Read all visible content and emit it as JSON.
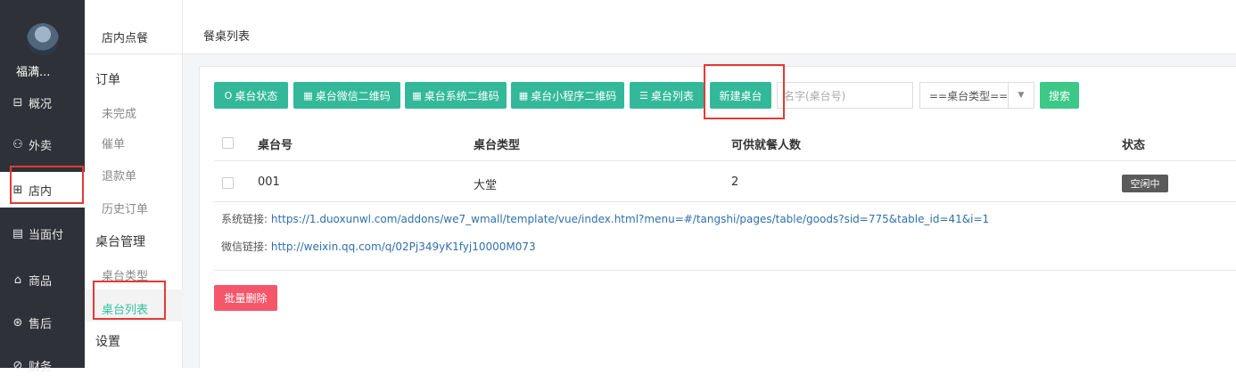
{
  "sidebar": {
    "shop_name": "福满...",
    "items": [
      {
        "icon": "dashboard-icon",
        "glyph": "⊟",
        "label": "概况"
      },
      {
        "icon": "delivery-icon",
        "glyph": "⚇",
        "label": "外卖"
      },
      {
        "icon": "store-icon",
        "glyph": "⊞",
        "label": "店内"
      },
      {
        "icon": "document-icon",
        "glyph": "▤",
        "label": "当面付"
      },
      {
        "icon": "bag-icon",
        "glyph": "⌂",
        "label": "商品"
      },
      {
        "icon": "after-sale-icon",
        "glyph": "⊛",
        "label": "售后"
      },
      {
        "icon": "finance-icon",
        "glyph": "⊘",
        "label": "财务"
      }
    ]
  },
  "subnav": {
    "title": "店内点餐",
    "group_orders": "订单",
    "orders_items": [
      "未完成",
      "催单",
      "退款单",
      "历史订单"
    ],
    "group_tables": "桌台管理",
    "tables_items": [
      "桌台类型",
      "桌台列表"
    ],
    "group_settings": "设置"
  },
  "header": {
    "title": "餐桌列表"
  },
  "toolbar": {
    "buttons": [
      {
        "icon": "circle-icon",
        "glyph": "O",
        "label": "桌台状态"
      },
      {
        "icon": "qrcode-icon",
        "glyph": "▦",
        "label": "桌台微信二维码"
      },
      {
        "icon": "qrcode-icon",
        "glyph": "▦",
        "label": "桌台系统二维码"
      },
      {
        "icon": "qrcode-icon",
        "glyph": "▦",
        "label": "桌台小程序二维码"
      },
      {
        "icon": "list-icon",
        "glyph": "☰",
        "label": "桌台列表"
      },
      {
        "icon": "",
        "glyph": "",
        "label": "新建桌台"
      }
    ],
    "search_placeholder": "名字(桌台号)",
    "type_select_value": "==桌台类型==",
    "search_label": "搜索"
  },
  "table": {
    "columns": [
      "桌台号",
      "桌台类型",
      "可供就餐人数",
      "状态"
    ],
    "rows": [
      {
        "number": "001",
        "type": "大堂",
        "capacity": "2",
        "status": "空闲中"
      }
    ]
  },
  "links": {
    "system_label": "系统链接:",
    "system_url": "https://1.duoxunwl.com/addons/we7_wmall/template/vue/index.html?menu=#/tangshi/pages/table/goods?sid=775&table_id=41&i=1",
    "wechat_label": "微信链接:",
    "wechat_url": "http://weixin.qq.com/q/02Pj349yK1fyj10000M073"
  },
  "bulk_delete_label": "批量删除",
  "colors": {
    "accent": "#33b999",
    "danger": "#f5566a",
    "highlight": "#e53935",
    "sidebar": "#2f3138"
  }
}
